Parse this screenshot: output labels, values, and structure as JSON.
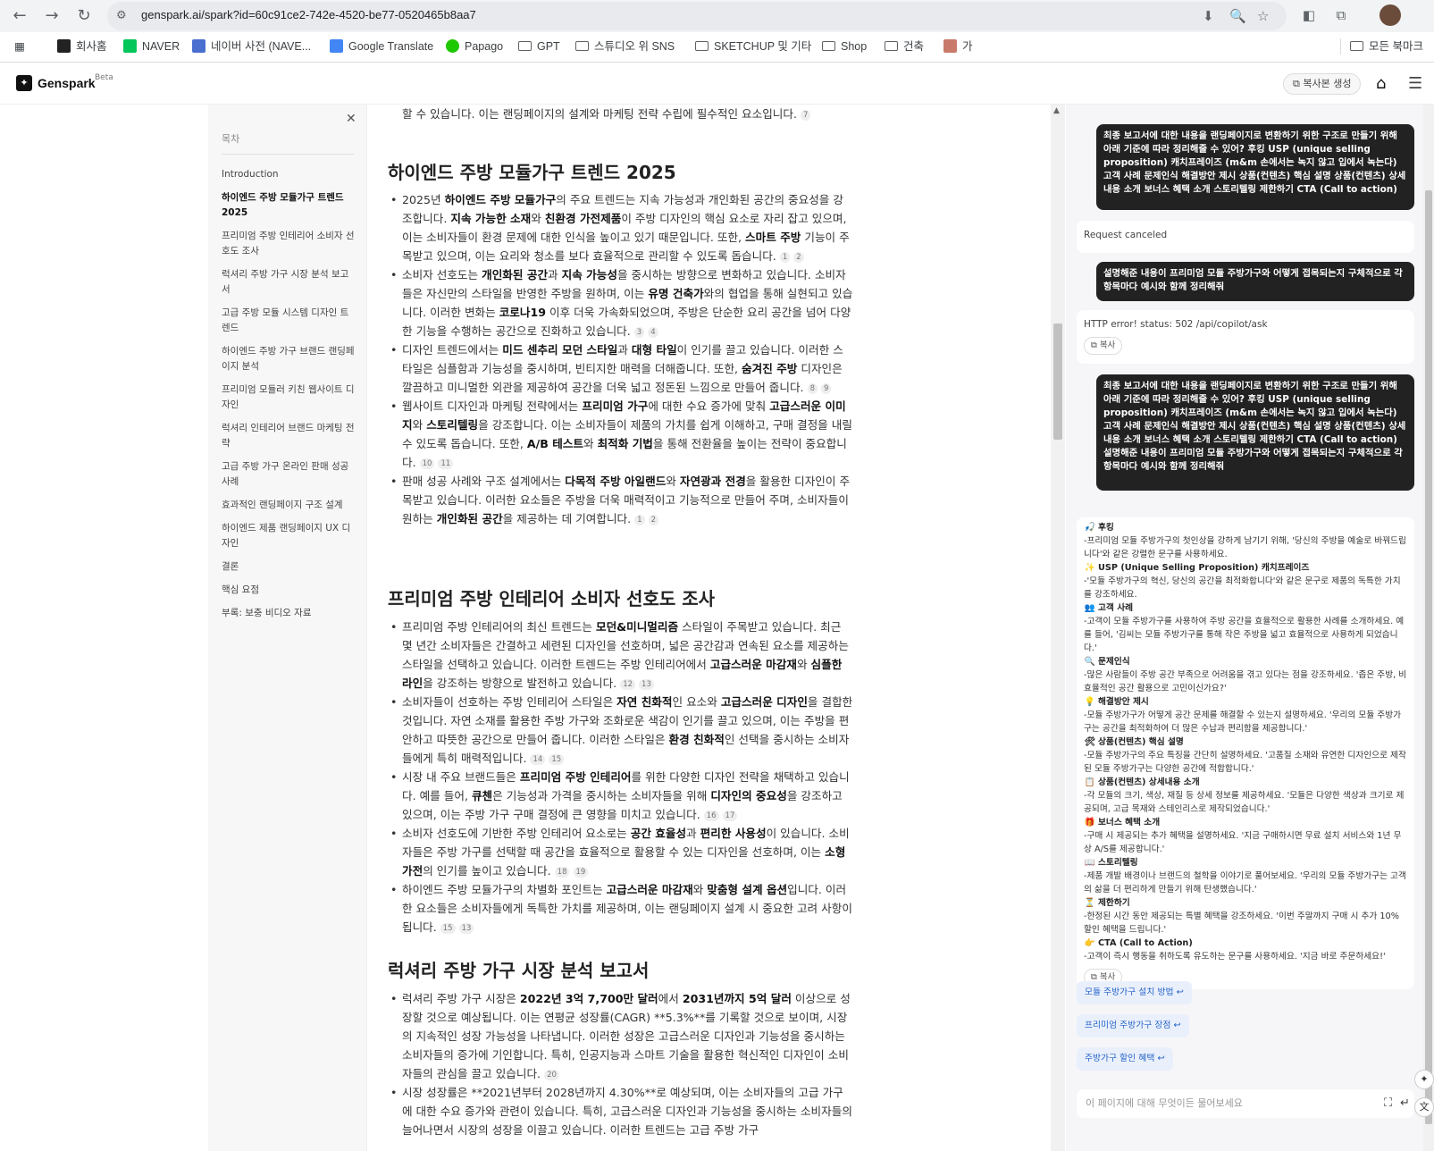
{
  "browser": {
    "url": "genspark.ai/spark?id=60c91ce2-742e-4520-be77-0520465b8aa7",
    "bookmarks": [
      "회사홈",
      "NAVER",
      "네이버 사전 (NAVE...",
      "Google Translate",
      "Papago",
      "GPT",
      "스튜디오 위 SNS",
      "SKETCHUP 및 기타",
      "Shop",
      "건축",
      "가"
    ],
    "all_bookmarks": "모든 북마크"
  },
  "app": {
    "logo": "Genspark",
    "beta": "Beta",
    "copy_gen": "복사본 생성"
  },
  "toc": {
    "title": "목차",
    "items": [
      "Introduction",
      "하이엔드 주방 모듈가구 트렌드 2025",
      "프리미엄 주방 인테리어 소비자 선호도 조사",
      "럭셔리 주방 가구 시장 분석 보고서",
      "고급 주방 모듈 시스템 디자인 트렌드",
      "하이엔드 주방 가구 브랜드 랜딩페이지 분석",
      "프리미엄 모듈러 키친 웹사이트 디자인",
      "럭셔리 인테리어 브랜드 마케팅 전략",
      "고급 주방 가구 온라인 판매 성공 사례",
      "효과적인 랜딩페이지 구조 설계",
      "하이엔드 제품 랜딩페이지 UX 디자인",
      "결론",
      "핵심 요점",
      "부록: 보충 비디오 자료"
    ]
  },
  "main": {
    "top_text": "할 수 있습니다. 이는 랜딩페이지의 설계와 마케팅 전략 수립에 필수적인 요소입니다.",
    "top_cite": "7",
    "s1_title": "하이엔드 주방 모듈가구 트렌드 2025",
    "s2_title": "프리미엄 주방 인테리어 소비자 선호도 조사",
    "s3_title": "럭셔리 주방 가구 시장 분석 보고서"
  },
  "chat": {
    "user_msg_1": "최종 보고서에 대한 내용을 랜딩페이지로 변환하기 위한 구조로 만들기 위해 아래 기준에 따라 정리해줄 수 있어? 후킹 USP (unique selling proposition) 캐치프레이즈 (m&m 손에서는 녹지 않고 입에서 녹는다) 고객 사례 문제인식 해결방안 제시 상품(컨텐츠) 핵심 설명 상품(컨텐츠) 상세내용 소개 보너스 혜택 소개 스토리텔링 제한하기 CTA (Call to action)",
    "sys_1": "Request canceled",
    "user_msg_2": "설명해준 내용이 프리미엄 모듈 주방가구와 어떻게 접목되는지 구체적으로 각 항목마다 예시와 함께 정리해줘",
    "sys_2": "HTTP error! status: 502 /api/copilot/ask",
    "copy": "복사",
    "user_msg_3": "최종 보고서에 대한 내용을 랜딩페이지로 변환하기 위한 구조로 만들기 위해 아래 기준에 따라 정리해줄 수 있어? 후킹 USP (unique selling proposition) 캐치프레이즈 (m&m 손에서는 녹지 않고 입에서 녹는다) 고객 사례 문제인식 해결방안 제시 상품(컨텐츠) 핵심 설명 상품(컨텐츠) 상세내용 소개 보너스 혜택 소개 스토리텔링 제한하기 CTA (Call to action) 설명해준 내용이 프리미엄 모듈 주방가구와 어떻게 접목되는지 구체적으로 각 항목마다 예시와 함께 정리해줘",
    "answer": [
      {
        "icon": "🎣",
        "h": "후킹",
        "t": "-프리미엄 모듈 주방가구의 첫인상을 강하게 남기기 위해, '당신의 주방을 예술로 바꿔드립니다'와 같은 강렬한 문구를 사용하세요."
      },
      {
        "icon": "✨",
        "h": "USP (Unique Selling Proposition) 캐치프레이즈",
        "t": "-'모듈 주방가구의 혁신, 당신의 공간을 최적화합니다'와 같은 문구로 제품의 독특한 가치를 강조하세요."
      },
      {
        "icon": "👥",
        "h": "고객 사례",
        "t": "-고객이 모듈 주방가구를 사용하여 주방 공간을 효율적으로 활용한 사례를 소개하세요. 예를 들어, '김씨는 모듈 주방가구를 통해 작은 주방을 넓고 효율적으로 사용하게 되었습니다.'"
      },
      {
        "icon": "🔍",
        "h": "문제인식",
        "t": "-많은 사람들이 주방 공간 부족으로 어려움을 겪고 있다는 점을 강조하세요. '좁은 주방, 비효율적인 공간 활용으로 고민이신가요?'"
      },
      {
        "icon": "💡",
        "h": "해결방안 제시",
        "t": "-모듈 주방가구가 어떻게 공간 문제를 해결할 수 있는지 설명하세요. '우리의 모듈 주방가구는 공간을 최적화하여 더 많은 수납과 편리함을 제공합니다.'"
      },
      {
        "icon": "🛠",
        "h": "상품(컨텐츠) 핵심 설명",
        "t": "-모듈 주방가구의 주요 특징을 간단히 설명하세요. '고품질 소재와 유연한 디자인으로 제작된 모듈 주방가구는 다양한 공간에 적합합니다.'"
      },
      {
        "icon": "📋",
        "h": "상품(컨텐츠) 상세내용 소개",
        "t": "-각 모듈의 크기, 색상, 재질 등 상세 정보를 제공하세요. '모듈은 다양한 색상과 크기로 제공되며, 고급 목재와 스테인리스로 제작되었습니다.'"
      },
      {
        "icon": "🎁",
        "h": "보너스 혜택 소개",
        "t": "-구매 시 제공되는 추가 혜택을 설명하세요. '지금 구매하시면 무료 설치 서비스와 1년 무상 A/S를 제공합니다.'"
      },
      {
        "icon": "📖",
        "h": "스토리텔링",
        "t": "-제품 개발 배경이나 브랜드의 철학을 이야기로 풀어보세요. '우리의 모듈 주방가구는 고객의 삶을 더 편리하게 만들기 위해 탄생했습니다.'"
      },
      {
        "icon": "⏳",
        "h": "제한하기",
        "t": "-한정된 시간 동안 제공되는 특별 혜택을 강조하세요. '이번 주말까지 구매 시 추가 10% 할인 혜택을 드립니다.'"
      },
      {
        "icon": "👉",
        "h": "CTA (Call to Action)",
        "t": "-고객이 즉시 행동을 취하도록 유도하는 문구를 사용하세요. '지금 바로 주문하세요!'"
      }
    ],
    "suggestions": [
      "모듈 주방가구 설치 방법 ↩",
      "프리미엄 주방가구 장점 ↩",
      "주방가구 할인 혜택 ↩"
    ],
    "input_placeholder": "이 페이지에 대해 무엇이든 물어보세요"
  }
}
